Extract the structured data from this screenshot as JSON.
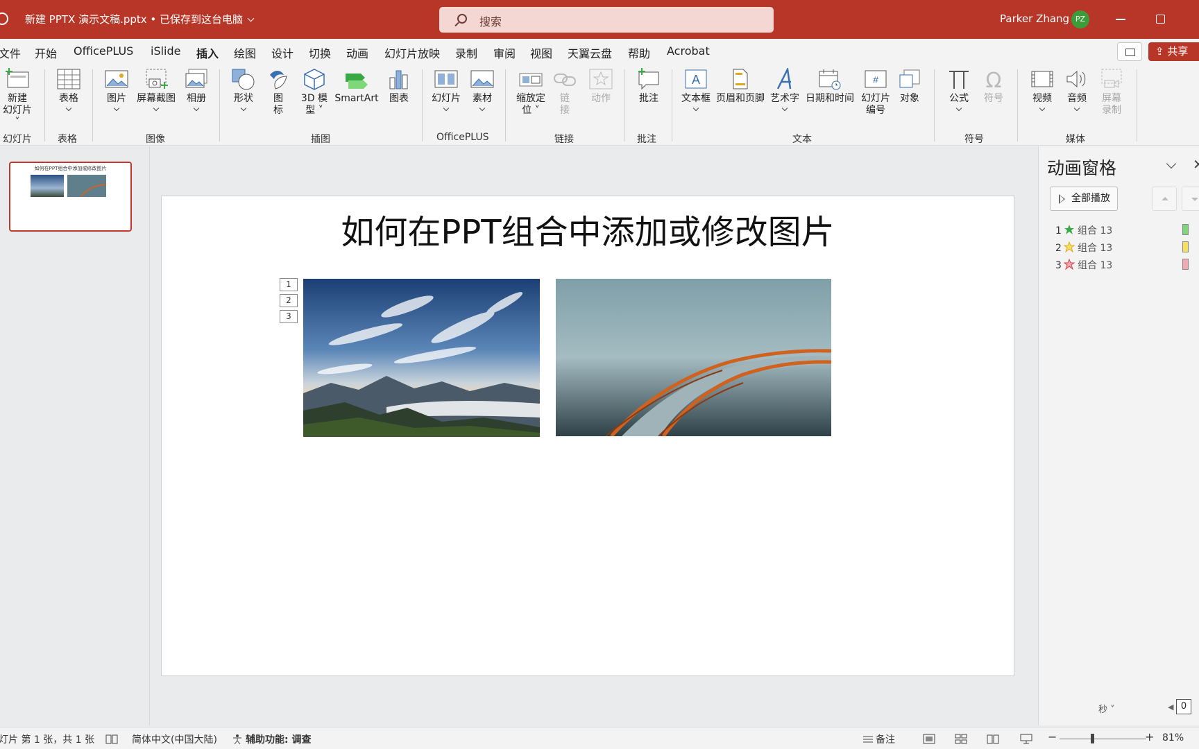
{
  "titlebar": {
    "filename": "新建 PPTX 演示文稿.pptx • 已保存到这台电脑",
    "search_placeholder": "搜索",
    "user_name": "Parker Zhang",
    "user_initials": "PZ"
  },
  "tabs": [
    "文件",
    "开始",
    "OfficePLUS",
    "iSlide",
    "插入",
    "绘图",
    "设计",
    "切换",
    "动画",
    "幻灯片放映",
    "录制",
    "审阅",
    "视图",
    "天翼云盘",
    "帮助",
    "Acrobat"
  ],
  "active_tab": "插入",
  "share_label": "共享",
  "ribbon": {
    "buttons": {
      "new_slide": [
        "新建",
        "幻灯片"
      ],
      "table": "表格",
      "picture": "图片",
      "screenshot": "屏幕截图",
      "album": "相册",
      "shapes": "形状",
      "icons": [
        "图",
        "标"
      ],
      "model3d": [
        "3D 模",
        "型"
      ],
      "smartart": "SmartArt",
      "chart": "图表",
      "slides": "幻灯片",
      "assets": "素材",
      "zoom": [
        "缩放定",
        "位"
      ],
      "link": [
        "链",
        "接"
      ],
      "action": "动作",
      "comment": "批注",
      "textbox": "文本框",
      "header_footer": "页眉和页脚",
      "wordart": "艺术字",
      "datetime": "日期和时间",
      "slide_number": [
        "幻灯片",
        "编号"
      ],
      "object": "对象",
      "equation": "公式",
      "symbol": "符号",
      "video": "视频",
      "audio": "音频",
      "screen_record": [
        "屏幕",
        "录制"
      ]
    },
    "groups": [
      "幻灯片",
      "表格",
      "图像",
      "插图",
      "OfficePLUS",
      "链接",
      "批注",
      "文本",
      "符号",
      "媒体"
    ]
  },
  "thumbnail": {
    "title": "如何在PPT组合中添加或修改图片"
  },
  "slide": {
    "title": "如何在PPT组合中添加或修改图片",
    "anim_tags": [
      "1",
      "2",
      "3"
    ]
  },
  "anim_pane": {
    "title": "动画窗格",
    "play_all": "全部播放",
    "items": [
      {
        "num": "1",
        "label": "组合 13",
        "star_color": "#3aa845",
        "bar_color": "#7ed87a"
      },
      {
        "num": "2",
        "label": "组合 13",
        "star_color": "#e0a820",
        "bar_color": "#f5e060"
      },
      {
        "num": "3",
        "label": "组合 13",
        "star_color": "#d8404a",
        "bar_color": "#f4a8b0"
      }
    ],
    "seconds_label": "秒",
    "page_indicator": "0"
  },
  "statusbar": {
    "slide_info": "灯片 第 1 张，共 1 张",
    "language": "简体中文(中国大陆)",
    "accessibility": "辅助功能: 调查",
    "notes": "备注",
    "zoom": "81%"
  },
  "colors": {
    "accent": "#b83627",
    "ribbon_bg": "#f3f3f3",
    "canvas_bg": "#e9ebec"
  }
}
